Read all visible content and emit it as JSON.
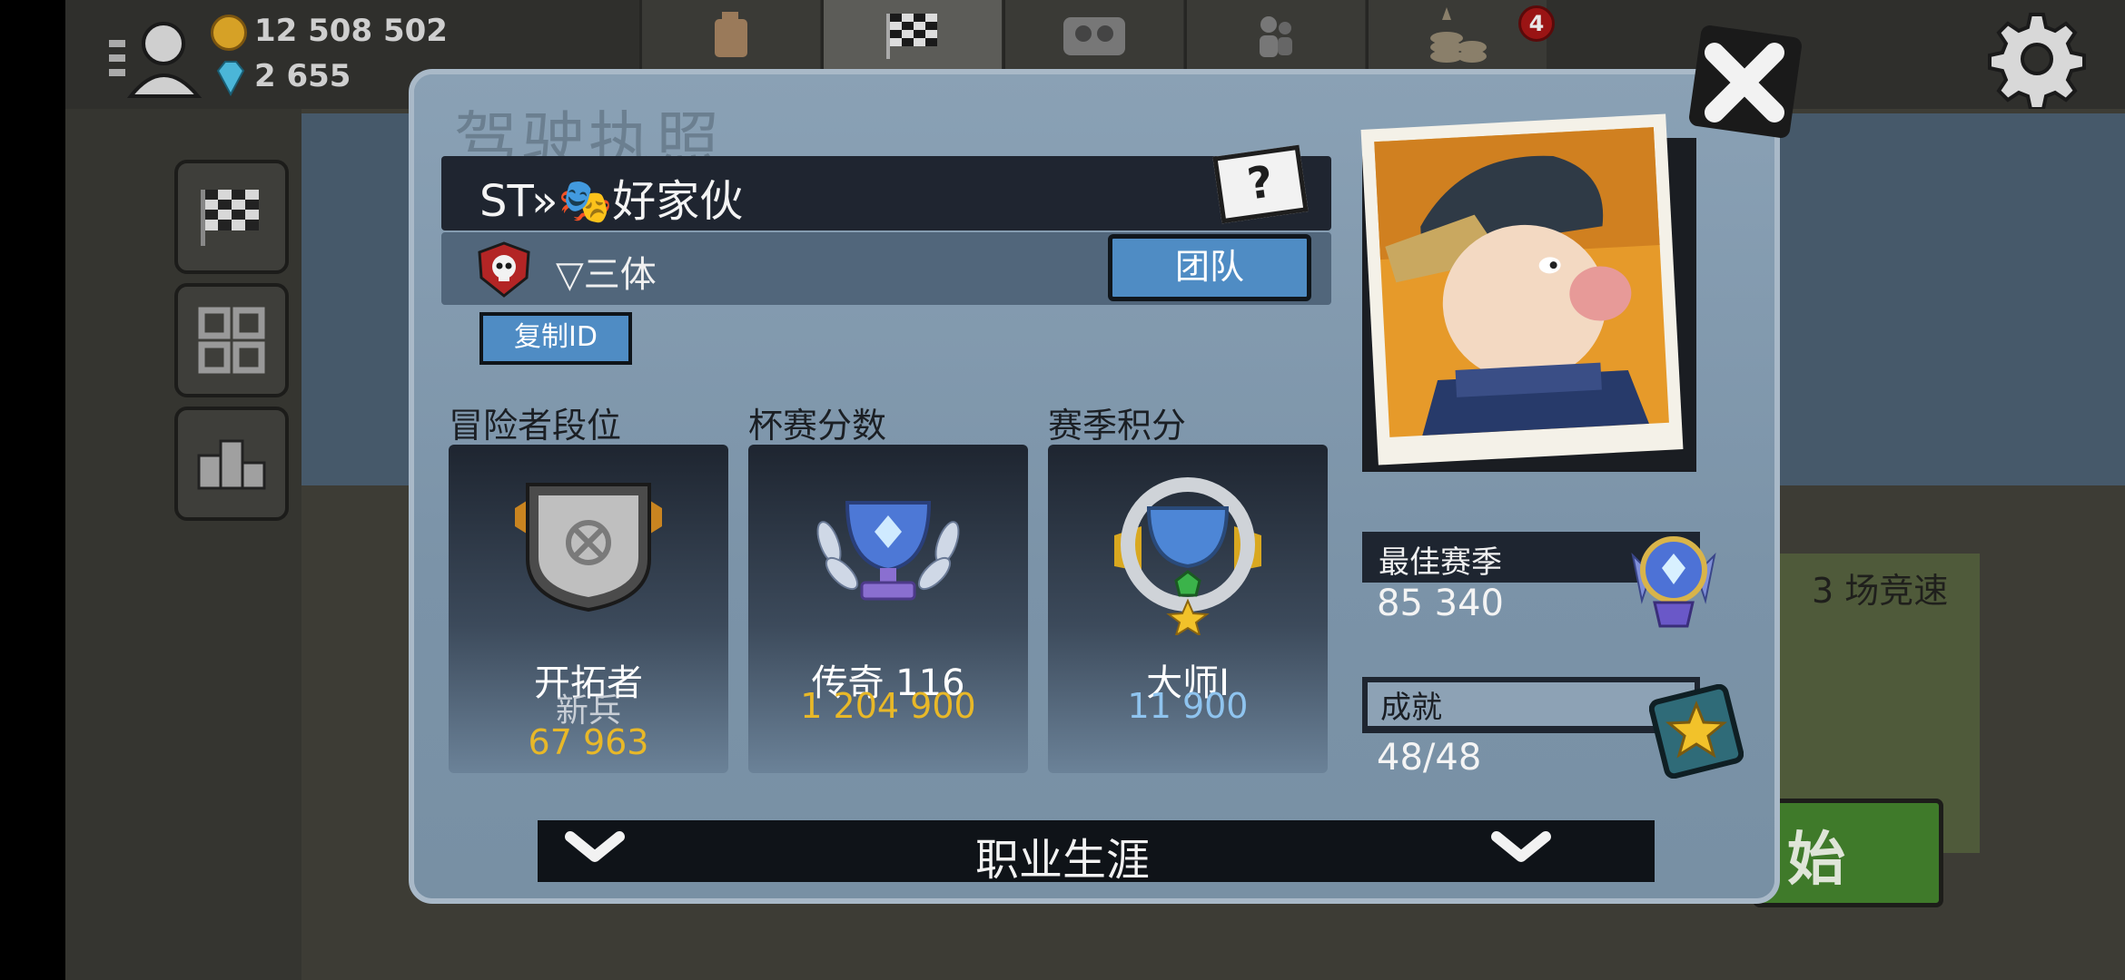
{
  "hud": {
    "coins": "12 508 502",
    "gems": "2 655",
    "notification_count": "4"
  },
  "background": {
    "race_count_text": "3 场竞速",
    "start_text": "始"
  },
  "modal": {
    "title": "驾驶执照",
    "player_name": "ST»🎭好家伙",
    "help_label": "?",
    "team_name": "▽三体",
    "team_button": "团队",
    "copy_id_button": "复制ID",
    "sections": [
      {
        "label": "冒险者段位",
        "title": "开拓者",
        "sub": "新兵",
        "value": "67 963"
      },
      {
        "label": "杯赛分数",
        "title": "传奇 116",
        "value": "1 204 900"
      },
      {
        "label": "赛季积分",
        "title": "大师I",
        "value": "11 900"
      }
    ],
    "best_season_label": "最佳赛季",
    "best_season_value": "85 340",
    "achievements_label": "成就",
    "achievements_value": "48/48",
    "career_label": "职业生涯"
  },
  "colors": {
    "accent_blue": "#4f8cc4",
    "gold": "#e8b828",
    "light_blue": "#8fc4ef",
    "panel": "#7d95aa"
  }
}
